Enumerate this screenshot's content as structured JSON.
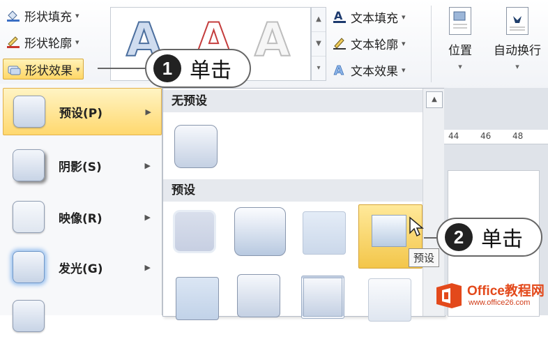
{
  "ribbon": {
    "shape_fill": "形状填充",
    "shape_outline": "形状轮廓",
    "shape_effect": "形状效果",
    "gallery_letter": "A",
    "text_fill": "文本填充",
    "text_outline": "文本轮廓",
    "text_effect": "文本效果",
    "position": "位置",
    "wrap_text": "自动换行"
  },
  "menu": {
    "items": [
      {
        "label": "预设(P)"
      },
      {
        "label": "阴影(S)"
      },
      {
        "label": "映像(R)"
      },
      {
        "label": "发光(G)"
      }
    ]
  },
  "submenu": {
    "no_preset": "无预设",
    "preset": "预设"
  },
  "ruler": {
    "ticks": [
      "44",
      "46",
      "48"
    ]
  },
  "tooltip": {
    "text": "预设"
  },
  "callouts": [
    {
      "num": "1",
      "text": "单击"
    },
    {
      "num": "2",
      "text": "单击"
    }
  ],
  "watermark": {
    "brand": "Office教程网",
    "url": "www.office26.com"
  },
  "colors": {
    "accent": "#ffd766",
    "callout_border": "#666666",
    "watermark": "#e3491b"
  }
}
